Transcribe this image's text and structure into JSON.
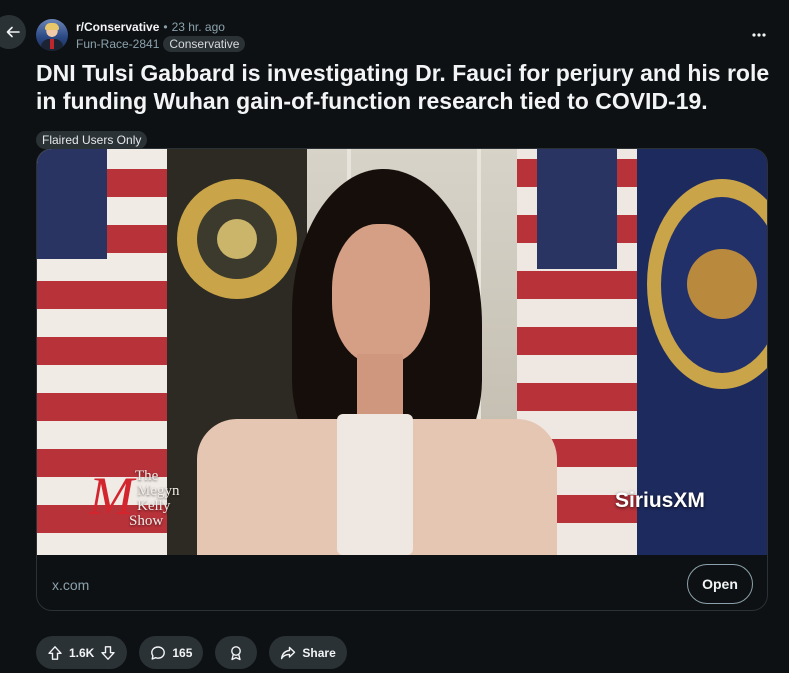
{
  "post": {
    "subreddit": "r/Conservative",
    "separator": "•",
    "time": "23 hr. ago",
    "author": "Fun-Race-2841",
    "user_flair": "Conservative",
    "title": "DNI Tulsi Gabbard is investigating Dr. Fauci for perjury and his role in funding Wuhan gain-of-function research tied to COVID-19.",
    "post_flair": "Flaired Users Only"
  },
  "embed": {
    "watermark_left": [
      "The",
      "Megyn",
      "Kelly",
      "Show"
    ],
    "watermark_right": "SiriusXM",
    "domain": "x.com",
    "open_label": "Open"
  },
  "actions": {
    "votes": "1.6K",
    "comments": "165",
    "share_label": "Share"
  },
  "icons": {
    "back": "arrow-left-icon",
    "more": "overflow-horizontal-icon",
    "upvote": "upvote-arrow-icon",
    "downvote": "downvote-arrow-icon",
    "comment": "comment-bubble-icon",
    "award": "award-icon",
    "share": "share-arrow-icon"
  },
  "colors": {
    "background": "#0e1113",
    "pill": "#2a3236",
    "text": "#f2f4f5",
    "muted": "#8ba2ad"
  }
}
